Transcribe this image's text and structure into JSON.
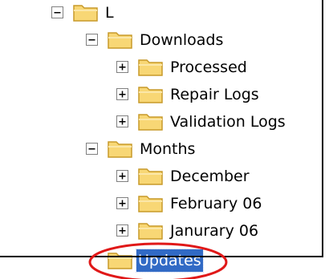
{
  "tree": {
    "items": [
      {
        "label": "L",
        "expander": "minus"
      },
      {
        "label": "Downloads",
        "expander": "minus"
      },
      {
        "label": "Processed",
        "expander": "plus"
      },
      {
        "label": "Repair Logs",
        "expander": "plus"
      },
      {
        "label": "Validation Logs",
        "expander": "plus"
      },
      {
        "label": "Months",
        "expander": "minus"
      },
      {
        "label": "December",
        "expander": "plus"
      },
      {
        "label": "February 06",
        "expander": "plus"
      },
      {
        "label": "Janurary 06",
        "expander": "plus"
      },
      {
        "label": "Updates",
        "expander": "none",
        "selected": true
      }
    ]
  },
  "colors": {
    "selection": "#316ac5",
    "annotation_ring": "#e01818",
    "folder_fill": "#f8d775",
    "folder_stroke": "#c79a2a"
  },
  "icons": {
    "collapse": "minus-box-icon",
    "expand": "plus-box-icon",
    "folder": "folder-icon"
  }
}
